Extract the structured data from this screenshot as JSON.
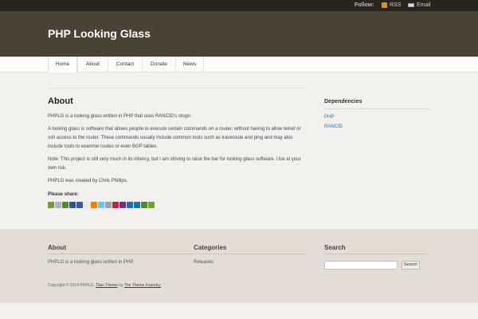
{
  "topbar": {
    "follow_label": "Follow:",
    "rss_label": "RSS",
    "email_label": "Email"
  },
  "site_title": "PHP Looking Glass",
  "nav": [
    {
      "label": "Home"
    },
    {
      "label": "About"
    },
    {
      "label": "Contact"
    },
    {
      "label": "Donate"
    },
    {
      "label": "News"
    }
  ],
  "nav_current": "About",
  "content": {
    "title": "About",
    "p1": "PHPLG is a looking glass written in PHP that uses RANCID's clogin.",
    "p2": "A looking glass is software that allows people to execute certain commands on a router, without having to allow telnet or ssh access to the router. These commands usually include common tools such as traceroute and ping and may also include tools to examine routes or even BGP tables.",
    "p3": "Note: This project is still very much in its infancy, but I am striving to raise the bar for looking glass software. Use at your own risk.",
    "p4": "PHPLG was created by Chris Phillips.",
    "share_heading": "Please share:"
  },
  "sidebar": {
    "heading": "Dependencies",
    "links": [
      "PHP",
      "RANCID"
    ]
  },
  "footer": {
    "about_heading": "About",
    "about_text": "PHPLG is a looking glass written in PHP.",
    "categories_heading": "Categories",
    "categories": [
      "Releases"
    ],
    "search_heading": "Search",
    "search_button": "Search",
    "search_value": "",
    "copyright_prefix": "Copyright © 2014 PHPLG.",
    "theme_name": "Titan Theme",
    "by": "by",
    "theme_author": "The Theme Foundry."
  },
  "colors": {
    "topbar": "#2a241e",
    "masthead": "#4b4236",
    "footer": "#e3ddd5",
    "link": "#2a6aa6"
  },
  "share_icons": [
    {
      "name": "print-icon",
      "color": "#7a9a3a"
    },
    {
      "name": "digg-icon",
      "color": "#aab5c8"
    },
    {
      "name": "stumbleupon-icon",
      "color": "#4c8a2e"
    },
    {
      "name": "delicious-icon",
      "color": "#3a4d9c"
    },
    {
      "name": "facebook-icon",
      "color": "#3b5998"
    },
    {
      "name": "google-bookmarks-icon",
      "color": "#e8e8e8"
    },
    {
      "name": "blogger-icon",
      "color": "#f57d00"
    },
    {
      "name": "twitter-icon",
      "color": "#6ec3e8"
    },
    {
      "name": "email-share-icon",
      "color": "#9aa3b4"
    },
    {
      "name": "myspace-icon",
      "color": "#c4233b"
    },
    {
      "name": "yahoo-icon",
      "color": "#6a2d91"
    },
    {
      "name": "live-icon",
      "color": "#2a6aa6"
    },
    {
      "name": "linkedin-icon",
      "color": "#0e76a8"
    },
    {
      "name": "technorati-icon",
      "color": "#4a8a2a"
    },
    {
      "name": "evernote-icon",
      "color": "#6aa42a"
    }
  ]
}
